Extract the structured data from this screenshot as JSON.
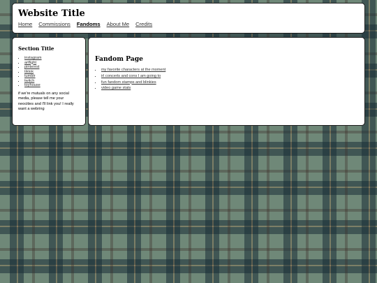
{
  "header": {
    "title": "Website Title",
    "nav": [
      "Home",
      "Commissions",
      "Fandoms",
      "About Me",
      "Credits"
    ],
    "active": "Fandoms"
  },
  "sidebar": {
    "title": "Section Title",
    "links": [
      "instagram",
      "artfight",
      "pinterest",
      "tiktok",
      "tumblr",
      "twitch",
      "toyhouse"
    ],
    "note": "if we're mutuals on any social media, please tell me your neocities and I'll link you! I really want a webring"
  },
  "main": {
    "title": "Fandom Page",
    "links": [
      "my favorite characters at the moment",
      "irl concerts and cons I am going to",
      "fun fandom stamps and blinkies",
      "video game stats"
    ]
  },
  "colors": {
    "background": "#6f8878",
    "panel": "#ffffff",
    "border": "#1a1a1a"
  }
}
